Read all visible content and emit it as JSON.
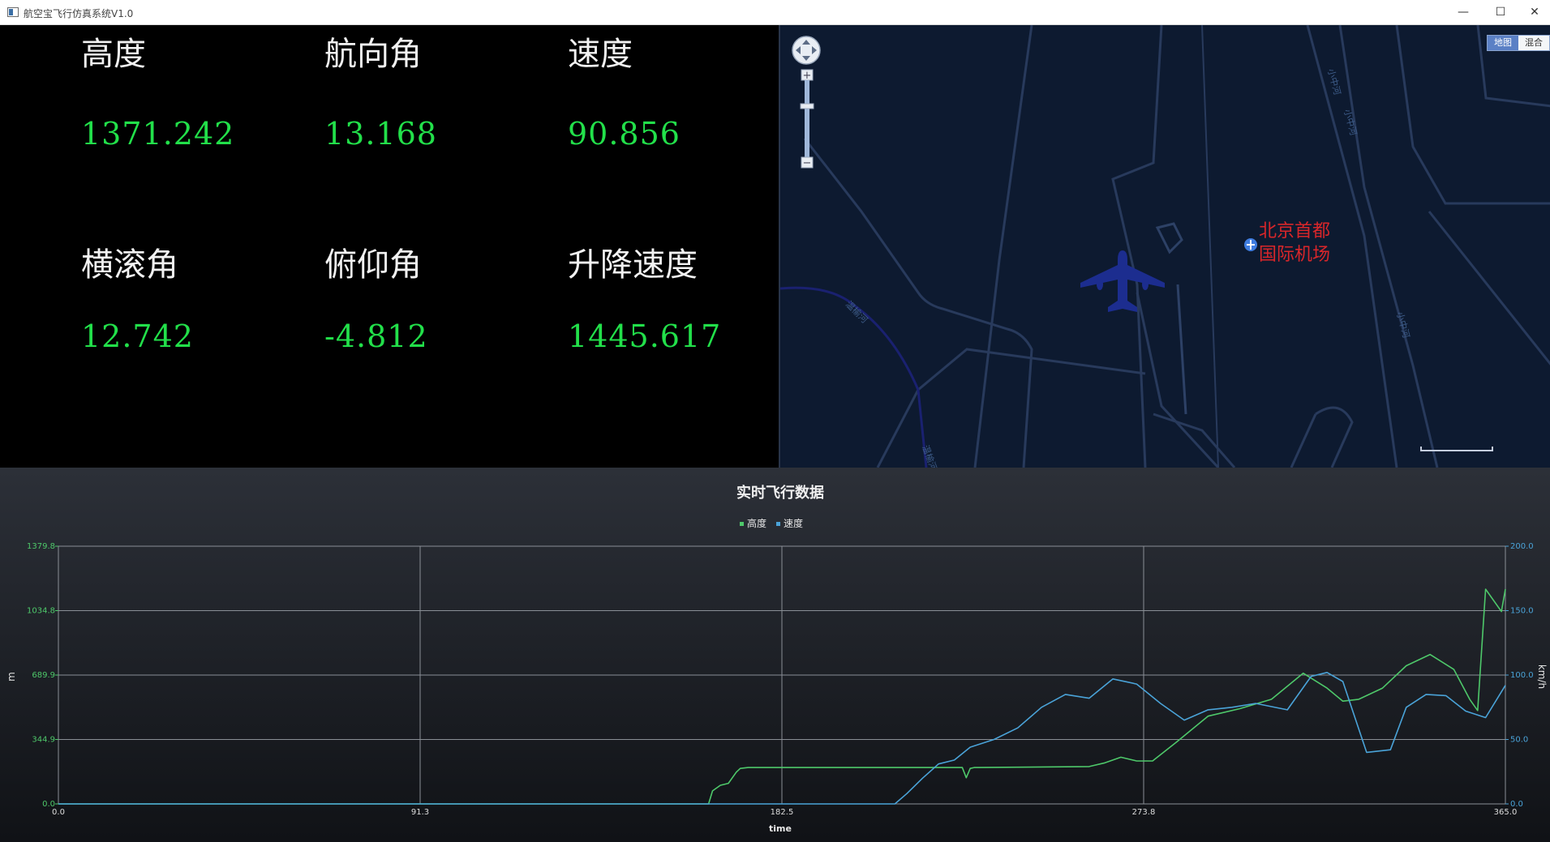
{
  "window": {
    "title": "航空宝飞行仿真系统V1.0",
    "controls": {
      "minimize": "—",
      "maximize": "☐",
      "close": "✕"
    }
  },
  "telemetry": [
    {
      "label": "高度",
      "value": "1371.242"
    },
    {
      "label": "航向角",
      "value": "13.168"
    },
    {
      "label": "速度",
      "value": "90.856"
    },
    {
      "label": "横滚角",
      "value": "12.742"
    },
    {
      "label": "俯仰角",
      "value": "-4.812"
    },
    {
      "label": "升降速度",
      "value": "1445.617"
    }
  ],
  "map": {
    "map_type_buttons": [
      "地图",
      "混合"
    ],
    "airport_name": "北京首都\n国际机场",
    "river_labels": [
      "小中河",
      "小中河",
      "小中河",
      "温榆河",
      "温榆河"
    ],
    "controls": {
      "zoom_in": "+",
      "zoom_out": "−"
    },
    "aircraft_icon": "airplane-icon",
    "airport_marker_icon": "airport-marker-icon",
    "colors": {
      "background": "#0d1a30",
      "road": "#283a5c",
      "river": "#1a2170",
      "aircraft": "#1c2d8f",
      "label": "#d9262a"
    }
  },
  "chart_data": {
    "type": "line",
    "title": "实时飞行数据",
    "xlabel": "time",
    "ylabel": "m",
    "y2label": "km/h",
    "xlim": [
      0,
      365
    ],
    "ylim": [
      0,
      1379.8
    ],
    "y2lim": [
      0,
      200
    ],
    "x_ticks": [
      "0.0",
      "91.3",
      "182.5",
      "273.8",
      "365.0"
    ],
    "y_ticks": [
      "0.0",
      "344.9",
      "689.9",
      "1034.8",
      "1379.8"
    ],
    "y2_ticks": [
      "0.0",
      "50.0",
      "100.0",
      "150.0",
      "200.0"
    ],
    "legend_position": "top-center",
    "grid": true,
    "series": [
      {
        "name": "高度",
        "axis": "left",
        "color": "#4ec86a",
        "x": [
          0,
          164,
          165,
          167,
          169,
          171,
          172,
          174,
          176,
          180,
          200,
          228,
          229,
          230,
          231,
          232,
          260,
          264,
          268,
          272,
          276,
          282,
          290,
          298,
          306,
          314,
          320,
          324,
          328,
          334,
          340,
          346,
          352,
          356,
          358,
          360,
          364,
          365
        ],
        "y": [
          0,
          0,
          70,
          100,
          110,
          170,
          190,
          195,
          195,
          195,
          195,
          195,
          140,
          190,
          195,
          195,
          200,
          220,
          250,
          230,
          230,
          330,
          470,
          510,
          560,
          700,
          620,
          550,
          560,
          620,
          740,
          800,
          720,
          560,
          500,
          1150,
          1030,
          1150
        ]
      },
      {
        "name": "速度",
        "axis": "right",
        "color": "#4aa3d8",
        "x": [
          0,
          211,
          214,
          218,
          222,
          226,
          230,
          236,
          242,
          248,
          254,
          260,
          266,
          272,
          278,
          284,
          290,
          296,
          302,
          310,
          316,
          320,
          324,
          330,
          336,
          340,
          345,
          350,
          355,
          360,
          365
        ],
        "y": [
          0,
          0,
          8,
          20,
          31,
          34,
          44,
          50,
          59,
          75,
          85,
          82,
          97,
          93,
          78,
          65,
          73,
          75,
          78,
          73,
          99,
          102,
          95,
          40,
          42,
          75,
          85,
          84,
          72,
          67,
          92
        ]
      }
    ]
  }
}
